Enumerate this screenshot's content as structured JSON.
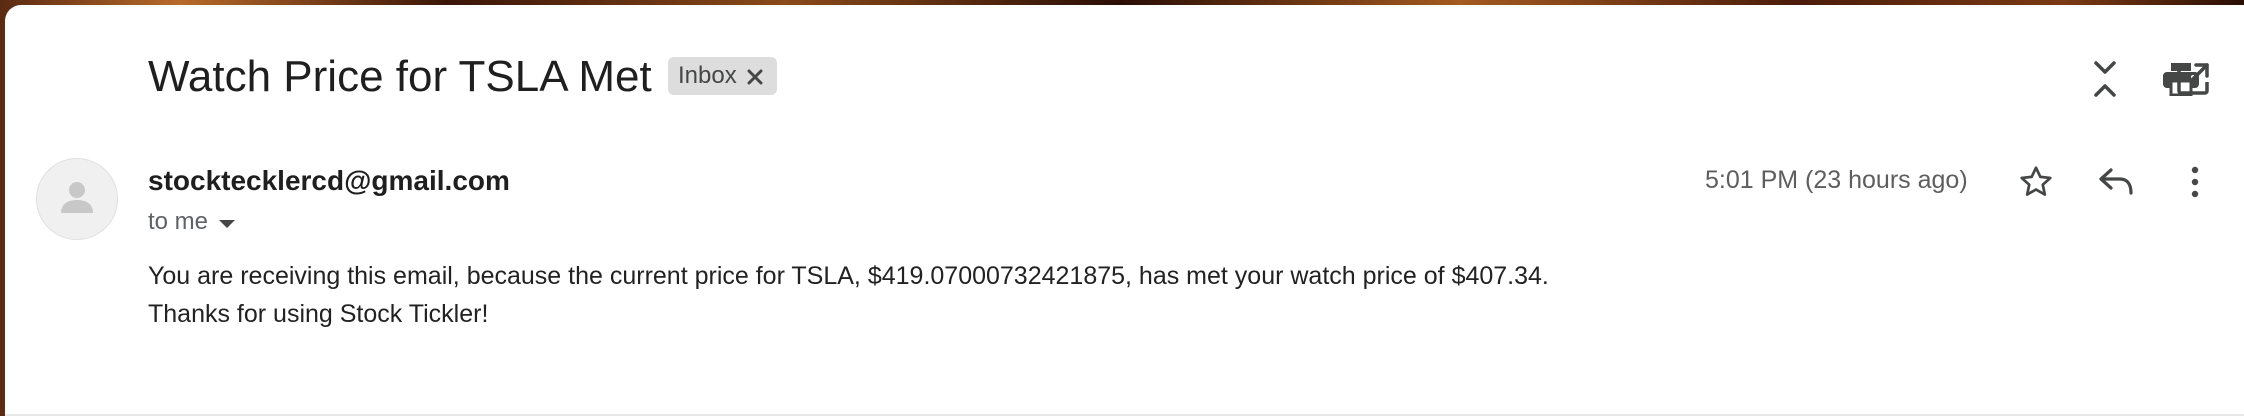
{
  "email": {
    "subject": "Watch Price for TSLA Met",
    "label": "Inbox",
    "sender": "stocktecklercd@gmail.com",
    "recipient_text": "to me",
    "timestamp": "5:01 PM (23 hours ago)",
    "body_lines": [
      "You are receiving this email, because the current price for TSLA, $419.07000732421875, has met your watch price of $407.34.",
      "Thanks for using Stock Tickler!"
    ]
  },
  "icons": {
    "expand_collapse": "unfold-less-icon",
    "print": "print-icon",
    "open_new_window": "open-in-new-icon",
    "star": "star-icon",
    "reply": "reply-icon",
    "more": "more-vert-icon",
    "remove_label": "close-icon",
    "avatar": "person-icon",
    "recipient_dropdown": "arrow-drop-down-icon"
  },
  "colors": {
    "text_primary": "#1f1f1f",
    "text_secondary": "#5f6368",
    "chip_background": "#dddddd",
    "icon": "#444746"
  }
}
